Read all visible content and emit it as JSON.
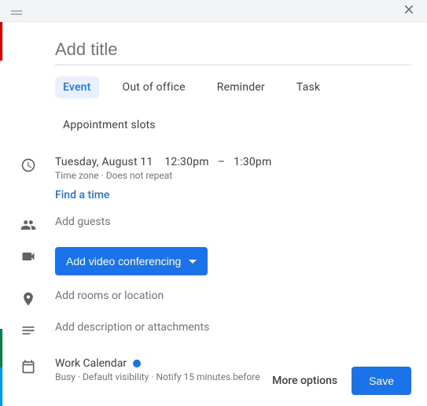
{
  "title_placeholder": "Add title",
  "tabs": [
    "Event",
    "Out of office",
    "Reminder",
    "Task",
    "Appointment slots"
  ],
  "active_tab": "Event",
  "time": {
    "date": "Tuesday, August 11",
    "start": "12:30pm",
    "sep": "–",
    "end": "1:30pm",
    "sub": "Time zone · Does not repeat",
    "find": "Find a time"
  },
  "guests_placeholder": "Add guests",
  "video_label": "Add video conferencing",
  "location_placeholder": "Add rooms or location",
  "description_placeholder": "Add description or attachments",
  "calendar": {
    "name": "Work Calendar",
    "sub": "Busy · Default visibility · Notify 15 minutes before",
    "color": "#1a73e8"
  },
  "footer": {
    "more": "More options",
    "save": "Save"
  }
}
